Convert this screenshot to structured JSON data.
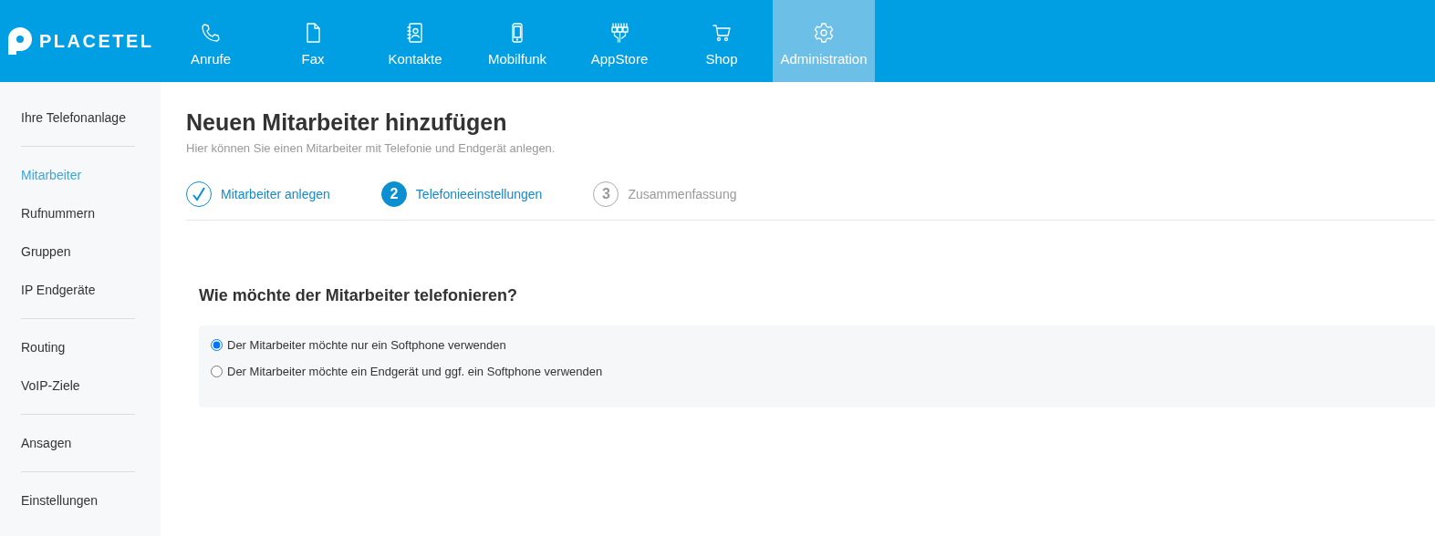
{
  "header": {
    "logo": "PLACETEL",
    "nav": [
      {
        "label": "Anrufe",
        "selected": false
      },
      {
        "label": "Fax",
        "selected": false
      },
      {
        "label": "Kontakte",
        "selected": false
      },
      {
        "label": "Mobilfunk",
        "selected": false
      },
      {
        "label": "AppStore",
        "selected": false
      },
      {
        "label": "Shop",
        "selected": false
      },
      {
        "label": "Administration",
        "selected": true
      }
    ]
  },
  "sidebar": {
    "groups": [
      [
        {
          "label": "Ihre Telefonanlage",
          "selected": false
        }
      ],
      [
        {
          "label": "Mitarbeiter",
          "selected": true
        },
        {
          "label": "Rufnummern",
          "selected": false
        },
        {
          "label": "Gruppen",
          "selected": false
        },
        {
          "label": "IP Endgeräte",
          "selected": false
        }
      ],
      [
        {
          "label": "Routing",
          "selected": false
        },
        {
          "label": "VoIP-Ziele",
          "selected": false
        }
      ],
      [
        {
          "label": "Ansagen",
          "selected": false
        }
      ],
      [
        {
          "label": "Einstellungen",
          "selected": false
        }
      ]
    ]
  },
  "page": {
    "title": "Neuen Mitarbeiter hinzufügen",
    "subtitle": "Hier können Sie einen Mitarbeiter mit Telefonie und Endgerät anlegen.",
    "steps": [
      {
        "label": "Mitarbeiter anlegen",
        "completed": true,
        "selected": false
      },
      {
        "number": "2",
        "label": "Telefonieeinstellungen",
        "completed": false,
        "selected": true
      },
      {
        "number": "3",
        "label": "Zusammenfassung",
        "completed": false,
        "selected": false
      }
    ],
    "question": "Wie möchte der Mitarbeiter telefonieren?",
    "options": [
      {
        "label": "Der Mitarbeiter möchte nur ein Softphone verwenden",
        "selected": true
      },
      {
        "label": "Der Mitarbeiter möchte ein Endgerät und ggf. ein Softphone verwenden",
        "selected": false
      }
    ]
  }
}
